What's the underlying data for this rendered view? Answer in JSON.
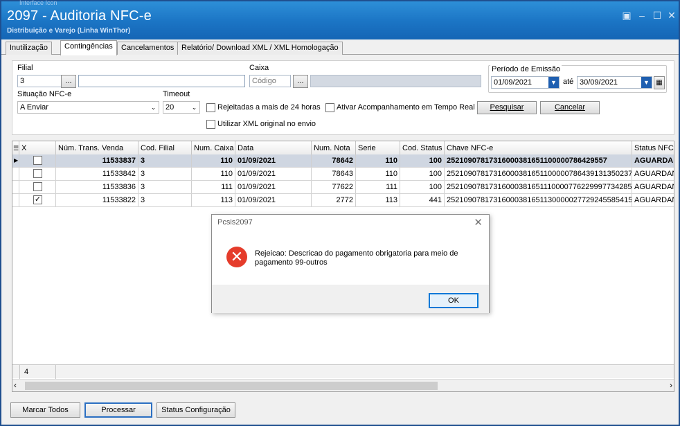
{
  "window": {
    "faint_text": "Interface Icon",
    "title": "2097 - Auditoria NFC-e",
    "subtitle": "Distribuição e Varejo (Linha WinThor)"
  },
  "tabs": [
    {
      "label": "Inutilização"
    },
    {
      "label": "Contingências",
      "active": true
    },
    {
      "label": "Cancelamentos"
    },
    {
      "label": "Relatório/ Download XML / XML Homologação"
    }
  ],
  "filters": {
    "filial_label": "Filial",
    "filial_value": "3",
    "filial_browse": "...",
    "caixa_label": "Caixa",
    "caixa_placeholder": "Código",
    "caixa_browse": "...",
    "periodo_label": "Período de Emissão",
    "date_from": "01/09/2021",
    "ate_label": "até",
    "date_to": "30/09/2021",
    "situacao_label": "Situação NFC-e",
    "situacao_value": "A Enviar",
    "timeout_label": "Timeout",
    "timeout_value": "20",
    "rejeitadas_label": "Rejeitadas a mais de 24 horas",
    "acompanhamento_label": "Ativar Acompanhamento em Tempo Real",
    "xml_original_label": "Utilizar XML original no envio",
    "pesquisar_label": "Pesquisar",
    "cancelar_label": "Cancelar"
  },
  "grid": {
    "headers": [
      "X",
      "Núm. Trans. Venda",
      "Cod. Filial",
      "Num. Caixa",
      "Data",
      "Num. Nota",
      "Serie",
      "Cod. Status",
      "Chave NFC-e",
      "Status NFC-"
    ],
    "rows": [
      {
        "checked": false,
        "trans": "11533837",
        "filial": "3",
        "caixa": "110",
        "data": "01/09/2021",
        "nota": "78642",
        "serie": "110",
        "status": "100",
        "chave": "25210907817316000381651100000786429557",
        "status_nfce": "AGUARDAN"
      },
      {
        "checked": false,
        "trans": "11533842",
        "filial": "3",
        "caixa": "110",
        "data": "01/09/2021",
        "nota": "78643",
        "serie": "110",
        "status": "100",
        "chave": "25210907817316000381651100000786439131350237",
        "status_nfce": "AGUARDAN"
      },
      {
        "checked": false,
        "trans": "11533836",
        "filial": "3",
        "caixa": "111",
        "data": "01/09/2021",
        "nota": "77622",
        "serie": "111",
        "status": "100",
        "chave": "25210907817316000381651110000776229997734285",
        "status_nfce": "AGUARDAN"
      },
      {
        "checked": true,
        "trans": "11533822",
        "filial": "3",
        "caixa": "113",
        "data": "01/09/2021",
        "nota": "2772",
        "serie": "113",
        "status": "441",
        "chave": "25210907817316000381651130000027729245585415",
        "status_nfce": "AGUARDAN"
      }
    ],
    "footer_count": "4"
  },
  "dialog": {
    "title": "Pcsis2097",
    "message": "Rejeicao: Descricao do pagamento obrigatoria para meio de pagamento 99-outros",
    "ok_label": "OK"
  },
  "buttons": {
    "marcar_todos": "Marcar Todos",
    "processar": "Processar",
    "status_config": "Status Configuração"
  }
}
